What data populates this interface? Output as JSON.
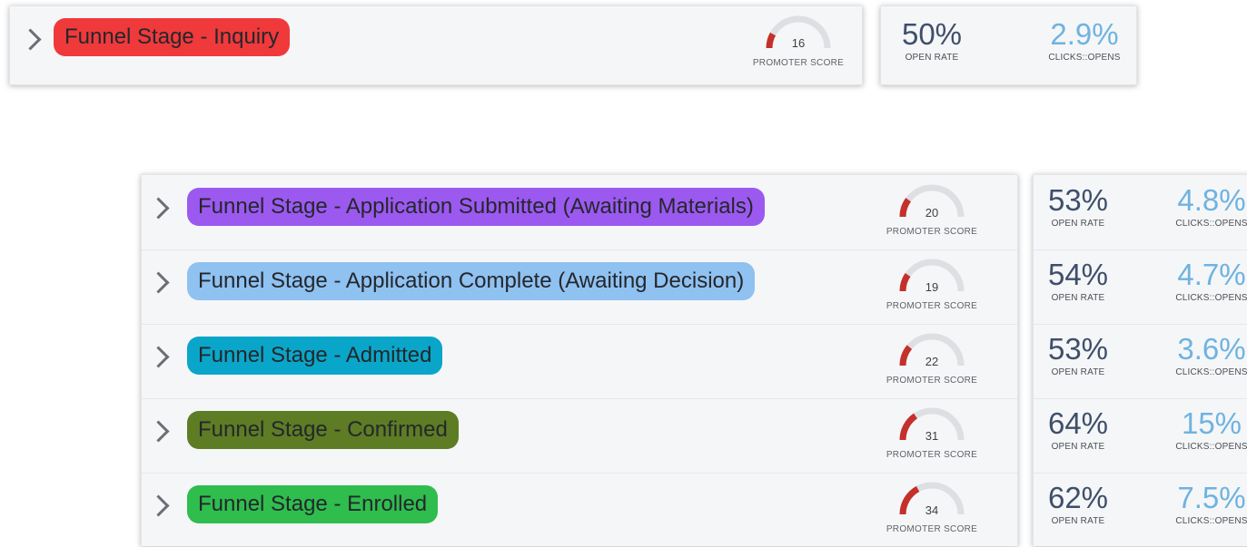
{
  "colors": {
    "inquiry": "#f0393b",
    "application_submitted": "#9b59f0",
    "application_complete": "#8fc1f1",
    "admitted": "#0aa6c9",
    "confirmed": "#5d7c24",
    "enrolled": "#2fbd4e",
    "gauge_fill": "#c4302b",
    "gauge_track": "#dddfe2"
  },
  "labels": {
    "promoter_score": "PROMOTER SCORE",
    "open_rate": "OPEN RATE",
    "clicks_opens": "CLICKS::OPENS"
  },
  "top": {
    "stage": {
      "name": "Funnel Stage - Inquiry",
      "color_key": "inquiry",
      "promoter_score": 16,
      "open_rate": "50%",
      "clicks_opens": "2.9%"
    }
  },
  "bottom": {
    "stages": [
      {
        "name": "Funnel Stage - Application Submitted (Awaiting Materials)",
        "color_key": "application_submitted",
        "promoter_score": 20,
        "open_rate": "53%",
        "clicks_opens": "4.8%"
      },
      {
        "name": "Funnel Stage - Application Complete (Awaiting Decision)",
        "color_key": "application_complete",
        "promoter_score": 19,
        "open_rate": "54%",
        "clicks_opens": "4.7%"
      },
      {
        "name": "Funnel Stage - Admitted",
        "color_key": "admitted",
        "promoter_score": 22,
        "open_rate": "53%",
        "clicks_opens": "3.6%"
      },
      {
        "name": "Funnel Stage - Confirmed",
        "color_key": "confirmed",
        "promoter_score": 31,
        "open_rate": "64%",
        "clicks_opens": "15%"
      },
      {
        "name": "Funnel Stage - Enrolled",
        "color_key": "enrolled",
        "promoter_score": 34,
        "open_rate": "62%",
        "clicks_opens": "7.5%"
      }
    ]
  }
}
